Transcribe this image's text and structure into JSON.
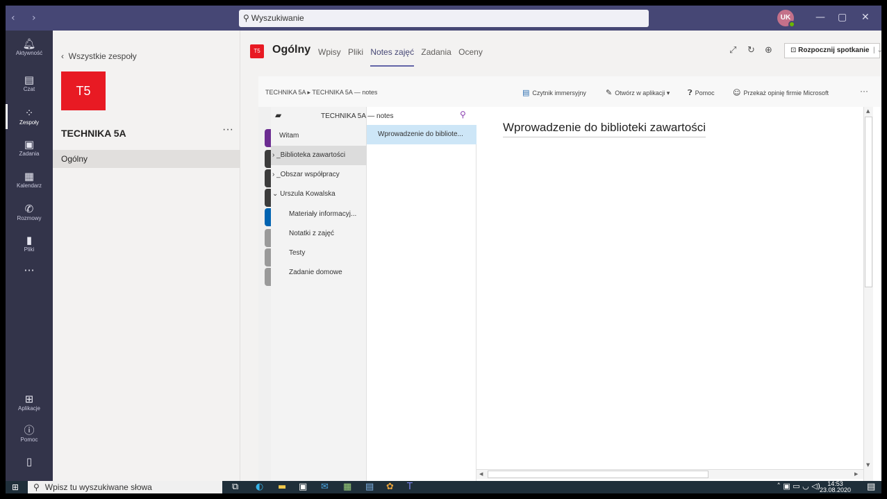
{
  "topbar": {
    "back_forward": "‹ ›",
    "search_placeholder": "Wyszukiwanie",
    "avatar_initials": "UK",
    "minimize": "—",
    "maximize": "▢",
    "close": "✕",
    "accent": "#464775"
  },
  "rail": {
    "items": [
      {
        "label": "Aktywność",
        "icon": "bell-icon"
      },
      {
        "label": "Czat",
        "icon": "chat-icon"
      },
      {
        "label": "Zespoły",
        "icon": "teams-icon"
      },
      {
        "label": "Zadania",
        "icon": "assignments-icon"
      },
      {
        "label": "Kalendarz",
        "icon": "calendar-icon"
      },
      {
        "label": "Rozmowy",
        "icon": "phone-icon"
      },
      {
        "label": "Pliki",
        "icon": "file-icon"
      }
    ],
    "more": "···",
    "apps_label": "Aplikacje",
    "help_label": "Pomoc",
    "active": "Zespoły"
  },
  "team_panel": {
    "back_label": "Wszystkie zespoły",
    "team_tile": "T5",
    "team_name": "TECHNIKA 5A",
    "more": "···",
    "channel": "Ogólny",
    "tile_color": "#e81a23"
  },
  "header": {
    "channel_tile": "T5",
    "channel_title": "Ogólny",
    "tabs": [
      "Wpisy",
      "Pliki",
      "Notes zajęć",
      "Zadania",
      "Oceny"
    ],
    "active_tab": "Notes zajęć",
    "meet_button": "Rozpocznij spotkanie"
  },
  "onenote": {
    "breadcrumb": "TECHNIKA 5A ▸ TECHNIKA 5A — notes",
    "toolbar": {
      "immersive_reader": "Czytnik immersyjny",
      "open_in_app": "Otwórz w aplikacji",
      "help": "Pomoc",
      "feedback": "Przekaż opinię firmie Microsoft",
      "more": "···"
    },
    "notebook_name": "TECHNIKA 5A — notes",
    "sections": [
      {
        "label": "Witam"
      },
      {
        "label": "_Biblioteka zawartości"
      },
      {
        "label": "_Obszar współpracy"
      },
      {
        "label": "Urszula Kowalska"
      },
      {
        "label": "Materiały informacyj..."
      },
      {
        "label": "Notatki z zajęć"
      },
      {
        "label": "Testy"
      },
      {
        "label": "Zadanie domowe"
      }
    ],
    "selected_section": "_Biblioteka zawartości",
    "pages": [
      "Wprowadzenie do bibliote..."
    ],
    "page_title": "Wprowadzenie do biblioteki zawartości"
  },
  "taskbar": {
    "search_placeholder": "Wpisz tu wyszukiwane słowa",
    "time": "14:53",
    "date": "23.08.2020"
  }
}
